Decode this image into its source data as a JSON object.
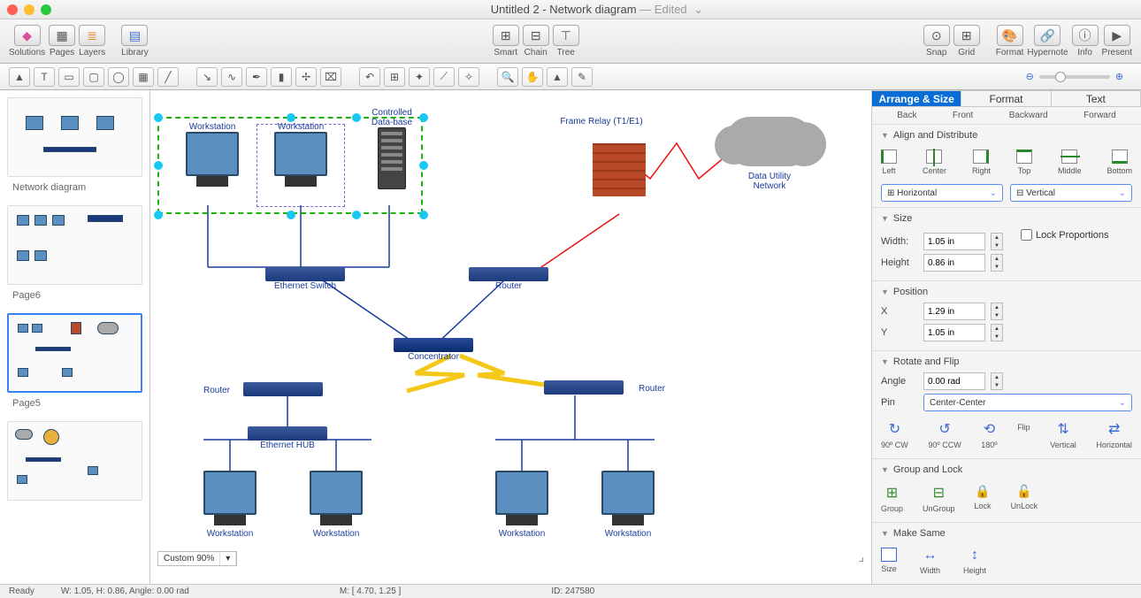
{
  "title": {
    "doc": "Untitled 2",
    "sub": "Network diagram",
    "state": "Edited"
  },
  "toolbar": {
    "solutions": "Solutions",
    "pages": "Pages",
    "layers": "Layers",
    "library": "Library",
    "smart": "Smart",
    "chain": "Chain",
    "tree": "Tree",
    "snap": "Snap",
    "grid": "Grid",
    "format": "Format",
    "hypernote": "Hypernote",
    "info": "Info",
    "present": "Present"
  },
  "pages": {
    "p1": "Network diagram",
    "p2": "Page6",
    "p3": "Page5"
  },
  "canvas": {
    "workstation": "Workstation",
    "controlled_db": "Controlled\nData-base",
    "frame_relay": "Frame Relay (T1/E1)",
    "data_utility": "Data Utility\nNetwork",
    "eth_switch": "Ethernet Switch",
    "router": "Router",
    "concentrator": "Concentrator",
    "eth_hub": "Ethernet HUB"
  },
  "zoom": {
    "label": "Custom 90%"
  },
  "inspector": {
    "tabs": {
      "arrange": "Arrange & Size",
      "format": "Format",
      "text": "Text"
    },
    "subtabs": {
      "back": "Back",
      "front": "Front",
      "backward": "Backward",
      "forward": "Forward"
    },
    "align": {
      "head": "Align and Distribute",
      "left": "Left",
      "center": "Center",
      "right": "Right",
      "top": "Top",
      "middle": "Middle",
      "bottom": "Bottom",
      "horiz": "Horizontal",
      "vert": "Vertical"
    },
    "size": {
      "head": "Size",
      "width_l": "Width:",
      "width_v": "1.05 in",
      "height_l": "Height",
      "height_v": "0.86 in",
      "lock": "Lock Proportions"
    },
    "position": {
      "head": "Position",
      "x_l": "X",
      "x_v": "1.29 in",
      "y_l": "Y",
      "y_v": "1.05 in"
    },
    "rotate": {
      "head": "Rotate and Flip",
      "angle_l": "Angle",
      "angle_v": "0.00 rad",
      "pin_l": "Pin",
      "pin_v": "Center-Center",
      "cw": "90º CW",
      "ccw": "90º CCW",
      "r180": "180º",
      "flip": "Flip",
      "fvert": "Vertical",
      "fhoriz": "Horizontal"
    },
    "group": {
      "head": "Group and Lock",
      "group": "Group",
      "ungroup": "UnGroup",
      "lock": "Lock",
      "unlock": "UnLock"
    },
    "same": {
      "head": "Make Same",
      "size": "Size",
      "width": "Width",
      "height": "Height"
    }
  },
  "status": {
    "ready": "Ready",
    "dims": "W: 1.05,  H: 0.86,  Angle: 0.00 rad",
    "mouse": "M: [ 4.70, 1.25 ]",
    "id": "ID: 247580"
  }
}
